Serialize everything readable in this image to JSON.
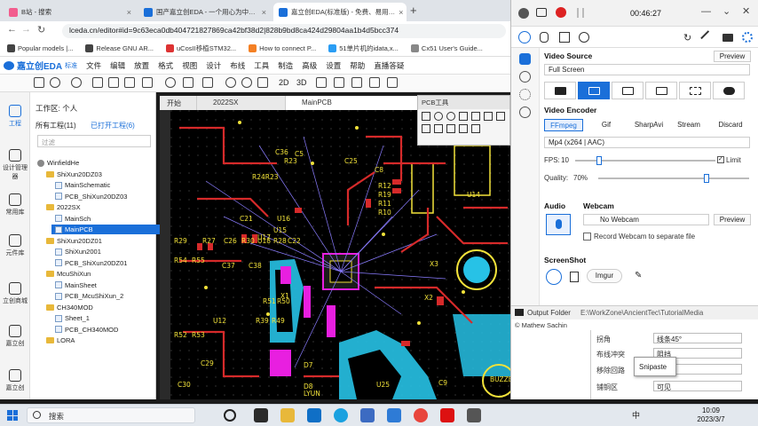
{
  "browser": {
    "tabs": [
      {
        "label": "B站 - 搜索"
      },
      {
        "label": "国产嘉立创EDA - 一个用心为中…"
      },
      {
        "label": "嘉立创EDA(标准版) - 免费、易用…"
      }
    ],
    "url": "lceda.cn/editor#id=9c63eca0db404721827869ca42bf38d2|828b9bd8ca424d29804aa1b4d5bcc374",
    "bookmarks": [
      "Popular models |...",
      "Release GNU AR...",
      "uCosII移植STM32...",
      "How to connect P...",
      "51单片机的idata,x...",
      "Cx51 User's Guide..."
    ]
  },
  "eda": {
    "logo": "嘉立创EDA",
    "edition": "标准",
    "menu": [
      "文件",
      "编辑",
      "放置",
      "格式",
      "视图",
      "设计",
      "布线",
      "工具",
      "制造",
      "高级",
      "设置",
      "帮助",
      "直播答疑"
    ],
    "zoom_2d": "2D",
    "zoom_3d": "3D",
    "rail": [
      "工程",
      "设计管理器",
      "常用库",
      "元件库",
      "立创商城",
      "嘉立创",
      "嘉立创"
    ],
    "workspace_label": "工作区: 个人",
    "all_projects": "所有工程(11)",
    "open_projects": "已打开工程(6)",
    "filter_placeholder": "过滤",
    "tree": [
      {
        "label": "WinfieldHe",
        "level": 0,
        "kind": "user"
      },
      {
        "label": "ShiXun20DZ03",
        "level": 1,
        "kind": "folder"
      },
      {
        "label": "MainSchematic",
        "level": 2,
        "kind": "file"
      },
      {
        "label": "PCB_ShiXun20DZ03",
        "level": 2,
        "kind": "file"
      },
      {
        "label": "2022SX",
        "level": 1,
        "kind": "folder"
      },
      {
        "label": "MainSch",
        "level": 2,
        "kind": "file"
      },
      {
        "label": "MainPCB",
        "level": 2,
        "kind": "file",
        "selected": true
      },
      {
        "label": "ShiXun20DZ01",
        "level": 1,
        "kind": "folder"
      },
      {
        "label": "ShiXun2001",
        "level": 2,
        "kind": "file"
      },
      {
        "label": "PCB_ShiXun20DZ01",
        "level": 2,
        "kind": "file"
      },
      {
        "label": "McuShiXun",
        "level": 1,
        "kind": "folder"
      },
      {
        "label": "MainSheet",
        "level": 2,
        "kind": "file"
      },
      {
        "label": "PCB_McuShiXun_2",
        "level": 2,
        "kind": "file"
      },
      {
        "label": "CH340MOD",
        "level": 1,
        "kind": "folder"
      },
      {
        "label": "Sheet_1",
        "level": 2,
        "kind": "file"
      },
      {
        "label": "PCB_CH340MOD",
        "level": 2,
        "kind": "file"
      },
      {
        "label": "LORA",
        "level": 1,
        "kind": "folder"
      }
    ],
    "doc_tabs": [
      "开始",
      "2022SX",
      "MainPCB"
    ],
    "pcb_tool_title": "PCB工具",
    "component_labels": [
      "C36",
      "R23",
      "C25",
      "R24R23",
      "C5",
      "C8",
      "R12",
      "R19",
      "R11",
      "R10",
      "U14",
      "C21",
      "U16",
      "U15",
      "R29",
      "U17",
      "R27",
      "C26",
      "R30",
      "U18",
      "R28",
      "C22",
      "R54",
      "R55",
      "C37",
      "C38",
      "R51",
      "R50",
      "R39",
      "R49",
      "U12",
      "X1",
      "X2",
      "X3",
      "R52",
      "R53",
      "C29",
      "D7",
      "D8",
      "LYUN",
      "BUZZER1",
      "C9",
      "U25",
      "C30"
    ],
    "properties": [
      {
        "label": "拐角",
        "value": "线条45°"
      },
      {
        "label": "布线冲突",
        "value": "阻挡"
      },
      {
        "label": "移除回路",
        "value": ""
      },
      {
        "label": "铺铜区",
        "value": "可见"
      }
    ]
  },
  "recorder": {
    "timer": "00:46:27",
    "video_source_label": "Video Source",
    "preview_label": "Preview",
    "video_source_value": "Full Screen",
    "video_encoder_label": "Video Encoder",
    "encoders": [
      "FFmpeg",
      "Gif",
      "SharpAvi",
      "Stream",
      "Discard"
    ],
    "codec": "Mp4 (x264 | AAC)",
    "fps_label": "FPS:",
    "fps_value": "10",
    "fps_fraction": 0.15,
    "limit_label": "Limit",
    "quality_label": "Quality:",
    "quality_value": "70%",
    "quality_fraction": 0.7,
    "audio_label": "Audio",
    "webcam_label": "Webcam",
    "webcam_value": "No Webcam",
    "webcam_preview": "Preview",
    "record_webcam_label": "Record Webcam to separate file",
    "screenshot_label": "ScreenShot",
    "screenshot_format": "Imgur",
    "output_label": "Output Folder",
    "output_path": "E:\\WorkZone\\AncientTec\\TutorialMedia",
    "credit": "© Mathew Sachin"
  },
  "snipaste": "Snipaste",
  "taskbar": {
    "search": "搜索",
    "ime": "中",
    "time": "10:09",
    "date": "2023/3/7"
  },
  "colors": {
    "accent": "#1a6fd9",
    "pcb_trace_red": "#d62a2a",
    "pcb_copper_blue": "#27c2e6",
    "pcb_silk_yellow": "#f2e23a",
    "pcb_magenta": "#e81fe0",
    "pcb_ratsnest": "#8a7cff"
  }
}
